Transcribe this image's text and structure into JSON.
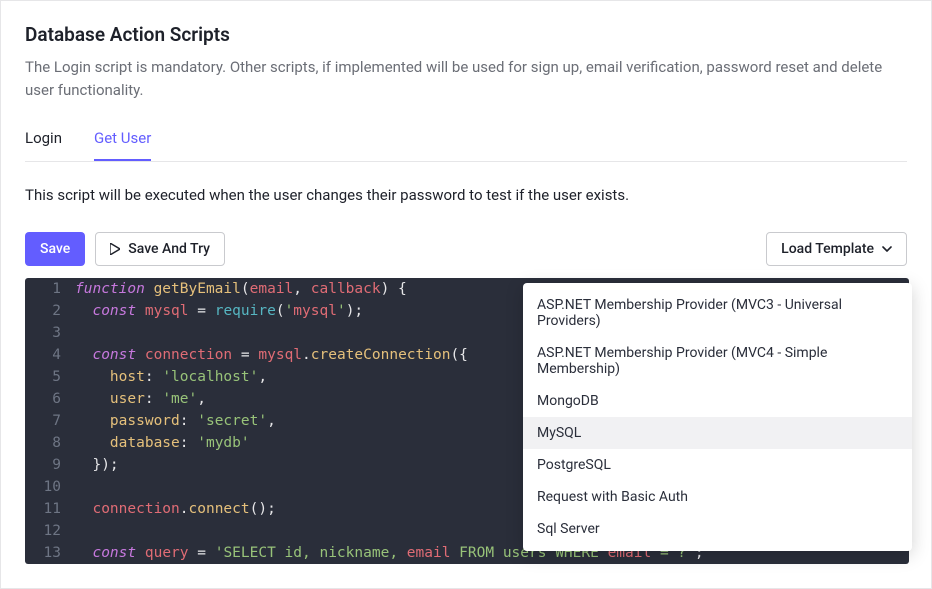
{
  "header": {
    "title": "Database Action Scripts",
    "description": "The Login script is mandatory. Other scripts, if implemented will be used for sign up, email verification, password reset and delete user functionality."
  },
  "tabs": {
    "login": "Login",
    "get_user": "Get User"
  },
  "sub_description": "This script will be executed when the user changes their password to test if the user exists.",
  "toolbar": {
    "save": "Save",
    "save_and_try": "Save And Try",
    "load_template": "Load Template"
  },
  "template_menu": {
    "items": [
      "ASP.NET Membership Provider (MVC3 - Universal Providers)",
      "ASP.NET Membership Provider (MVC4 - Simple Membership)",
      "MongoDB",
      "MySQL",
      "PostgreSQL",
      "Request with Basic Auth",
      "Sql Server"
    ],
    "highlighted_index": 3
  },
  "editor": {
    "lines": [
      "function getByEmail(email, callback) {",
      "  const mysql = require('mysql');",
      "",
      "  const connection = mysql.createConnection({",
      "    host: 'localhost',",
      "    user: 'me',",
      "    password: 'secret',",
      "    database: 'mydb'",
      "  });",
      "",
      "  connection.connect();",
      "",
      "  const query = 'SELECT id, nickname, email FROM users WHERE email = ?';"
    ]
  }
}
